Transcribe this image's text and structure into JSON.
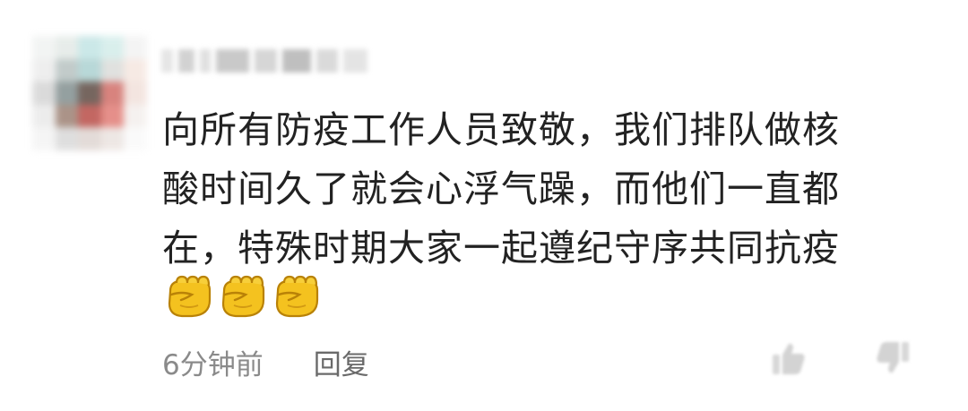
{
  "comment": {
    "text": "向所有防疫工作人员致敬，我们排队做核\n酸时间久了就会心浮气躁，而他们一直都\n在，特殊时期大家一起遵纪守序共同抗疫",
    "emojis": [
      "fist-emoji",
      "fist-emoji",
      "fist-emoji"
    ],
    "time": "6分钟前",
    "reply_label": "回复"
  },
  "actions": {
    "like_icon": "thumbs-up-icon",
    "dislike_icon": "thumbs-down-icon"
  },
  "colors": {
    "text": "#222222",
    "meta_text": "#8a8a8a",
    "emoji": "#f4c21f"
  }
}
